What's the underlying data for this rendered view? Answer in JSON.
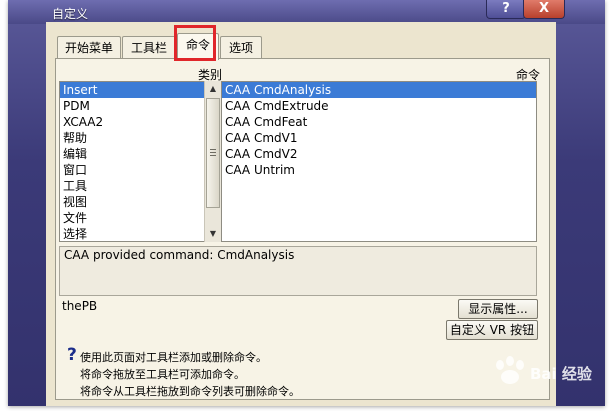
{
  "window": {
    "title": "自定义",
    "help_button": "?",
    "close_button": "X"
  },
  "tabs": [
    {
      "label": "开始菜单",
      "active": false
    },
    {
      "label": "工具栏",
      "active": false
    },
    {
      "label": "命令",
      "active": true
    },
    {
      "label": "选项",
      "active": false
    }
  ],
  "categories_label": "类别",
  "commands_label": "命令",
  "categories": [
    "Insert",
    "PDM",
    "XCAA2",
    "帮助",
    "编辑",
    "窗口",
    "工具",
    "视图",
    "文件",
    "选择"
  ],
  "selected_category": "Insert",
  "commands": [
    "CAA CmdAnalysis",
    "CAA CmdExtrude",
    "CAA CmdFeat",
    "CAA CmdV1",
    "CAA CmdV2",
    "CAA Untrim"
  ],
  "selected_command": "CAA CmdAnalysis",
  "description": "CAA provided command: CmdAnalysis",
  "toolbar_name": "thePB",
  "buttons": {
    "show_properties": "显示属性...",
    "customize_vr": "自定义 VR 按钮"
  },
  "help": {
    "icon": "question-mark-icon",
    "line1": "使用此页面对工具栏添加或删除命令。",
    "line2": "将命令拖放至工具栏可添加命令。",
    "line3": "将命令从工具栏拖放到命令列表可删除命令。"
  },
  "watermark": {
    "text": "Bai 经验"
  },
  "colors": {
    "chrome": "#3b3a78",
    "client": "#ece5cf",
    "selection": "#3b7bd6",
    "highlight_box": "#e0262a"
  }
}
